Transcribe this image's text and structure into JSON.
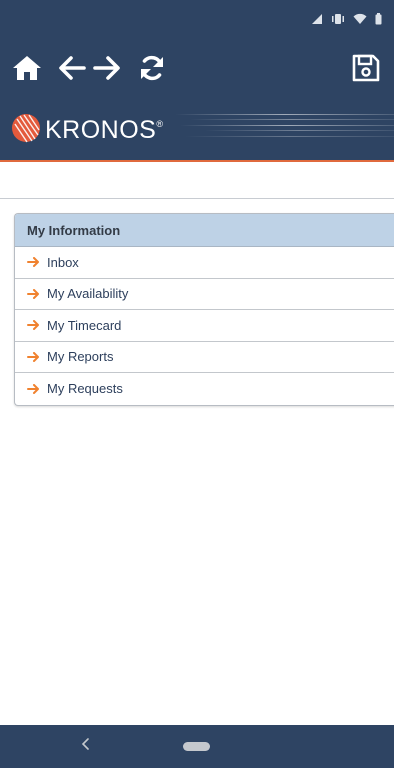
{
  "status_bar": {
    "icons": [
      "signal-icon",
      "vibrate-icon",
      "wifi-icon",
      "battery-icon"
    ]
  },
  "toolbar": {
    "icons": [
      "home-icon",
      "back-arrow-icon",
      "forward-arrow-icon",
      "refresh-icon",
      "save-icon"
    ]
  },
  "brand": {
    "name": "KRONOS",
    "mark": "®"
  },
  "panel": {
    "title": "My Information",
    "items": [
      {
        "label": "Inbox"
      },
      {
        "label": "My Availability"
      },
      {
        "label": "My Timecard"
      },
      {
        "label": "My Reports"
      },
      {
        "label": "My Requests"
      }
    ]
  },
  "colors": {
    "header_bg": "#2e4463",
    "accent": "#e06a3e",
    "arrow": "#f0822f",
    "panel_header_bg": "#bed2e6"
  }
}
